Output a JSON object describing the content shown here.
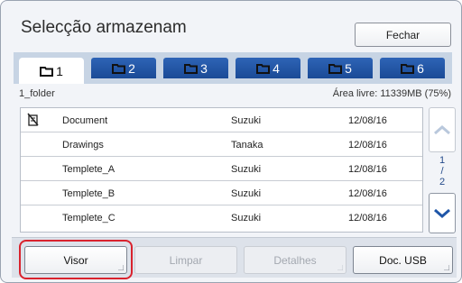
{
  "header": {
    "title": "Selecção armazenam",
    "close_label": "Fechar"
  },
  "tabs": [
    {
      "label": "1",
      "active": true
    },
    {
      "label": "2",
      "active": false
    },
    {
      "label": "3",
      "active": false
    },
    {
      "label": "4",
      "active": false
    },
    {
      "label": "5",
      "active": false
    },
    {
      "label": "6",
      "active": false
    }
  ],
  "folder": {
    "name": "1_folder",
    "free_space": "Área livre: 11339MB (75%)"
  },
  "files": [
    {
      "name": "Document",
      "owner": "Suzuki",
      "date": "12/08/16",
      "icon": "no-copy-icon"
    },
    {
      "name": "Drawings",
      "owner": "Tanaka",
      "date": "12/08/16",
      "icon": ""
    },
    {
      "name": "Templete_A",
      "owner": "Suzuki",
      "date": "12/08/16",
      "icon": ""
    },
    {
      "name": "Templete_B",
      "owner": "Suzuki",
      "date": "12/08/16",
      "icon": ""
    },
    {
      "name": "Templete_C",
      "owner": "Suzuki",
      "date": "12/08/16",
      "icon": ""
    }
  ],
  "pagination": {
    "current": "1",
    "sep": "/",
    "total": "2"
  },
  "actions": {
    "visor": "Visor",
    "limpar": "Limpar",
    "detalhes": "Detalhes",
    "doc_usb": "Doc. USB"
  },
  "colors": {
    "tab": "#1f56a8",
    "highlight": "#d9232e",
    "scroll_arrow": "#1f56a8"
  }
}
